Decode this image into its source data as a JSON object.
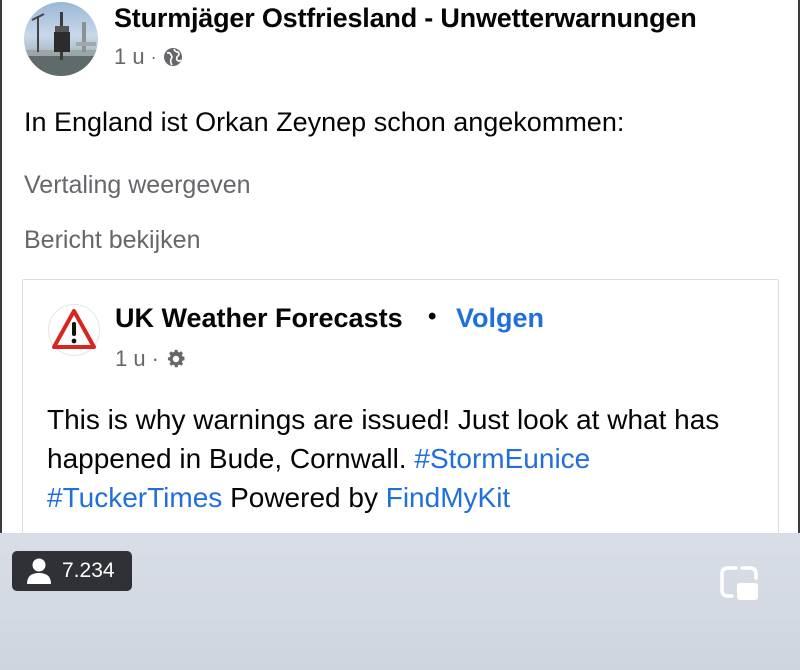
{
  "post": {
    "page_name": "Sturmjäger Ostfriesland - Unwetterwarnungen",
    "time": "1 u",
    "separator": "·",
    "visibility_icon": "globe-icon",
    "text": "In England ist Orkan Zeynep schon angekommen:",
    "translation_link": "Vertaling weergeven",
    "view_post_link": "Bericht bekijken"
  },
  "shared_post": {
    "page_name": "UK Weather Forecasts",
    "separator": "•",
    "follow_label": "Volgen",
    "time": "1 u",
    "meta_separator": "·",
    "settings_icon": "gear-icon",
    "text_part1": "This is why warnings are issued! Just look at what has happened in Bude, Cornwall. ",
    "hashtag1": "#StormEunice",
    "hashtag2": "#TuckerTimes",
    "text_part2": " Powered by ",
    "link": "FindMyKit"
  },
  "overlay": {
    "viewer_icon": "person-icon",
    "viewer_count": "7.234",
    "pip_icon": "picture-in-picture-icon"
  },
  "colors": {
    "link_blue": "#216fdb",
    "secondary_text": "#65676b",
    "badge_bg": "#2f3136"
  }
}
